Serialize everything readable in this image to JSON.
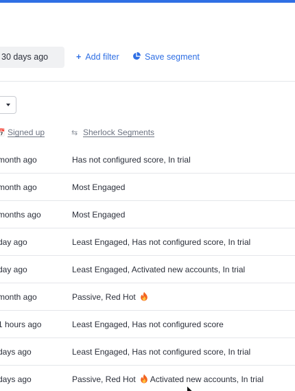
{
  "filters": {
    "date_value": "30 days ago",
    "add_filter_label": "Add filter",
    "save_segment_label": "Save segment"
  },
  "table": {
    "columns": [
      "Signed up",
      "Sherlock Segments"
    ],
    "rows": [
      {
        "signed_up": "month ago",
        "segments": "Has not configured score, In trial"
      },
      {
        "signed_up": "month ago",
        "segments": "Most Engaged"
      },
      {
        "signed_up": "months ago",
        "segments": "Most Engaged"
      },
      {
        "signed_up": "day ago",
        "segments": "Least Engaged, Has not configured score, In trial"
      },
      {
        "signed_up": "day ago",
        "segments": "Least Engaged, Activated new accounts, In trial"
      },
      {
        "signed_up": "month ago",
        "segments": "Passive, Red Hot",
        "flame": true
      },
      {
        "signed_up": "1 hours ago",
        "segments": "Least Engaged, Has not configured score"
      },
      {
        "signed_up": "days ago",
        "segments": "Least Engaged, Has not configured score, In trial"
      },
      {
        "signed_up": "days ago",
        "segments": "Passive, Red Hot",
        "segments_after": "Activated new accounts, In trial",
        "flame": true
      }
    ]
  },
  "icons": {
    "add_filter": "plus-icon",
    "save_segment": "pie-chart-icon",
    "signed_up_column": "calendar-icon",
    "sherlock_column": "sort-arrows-icon",
    "red_hot": "flame-icon"
  },
  "colors": {
    "accent": "#2f6fe4",
    "text": "#2b2f3a",
    "muted": "#6b7280",
    "divider": "#e4e6ea",
    "chip_bg": "#f0f1f3"
  }
}
